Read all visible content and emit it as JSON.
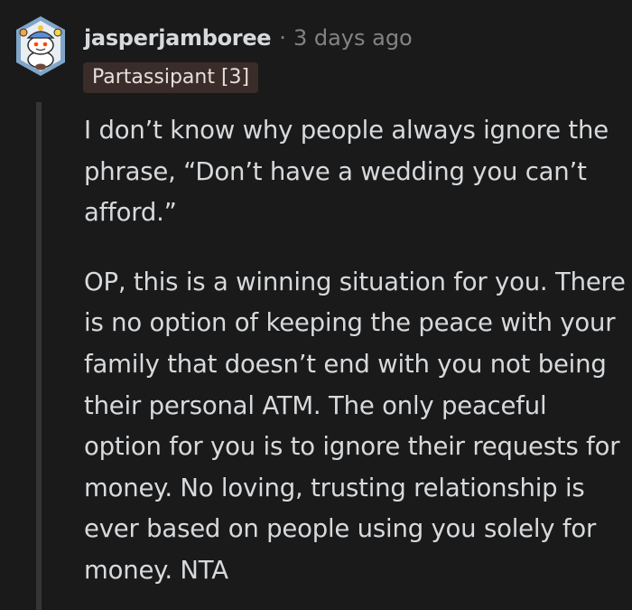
{
  "comment": {
    "author": "jasperjamboree",
    "separator": "·",
    "timestamp": "3 days ago",
    "flair": "Partassipant [3]",
    "avatar_icon": "snoo-avatar-icon",
    "paragraphs": [
      "I don’t know why people always ignore the phrase, “Don’t have a wedding you can’t afford.”",
      "OP, this is a winning situation for you. There is no option of keeping the peace with your family that doesn’t end with you not being their personal ATM. The only peaceful option for you is to ignore their requests for money. No loving, trusting relationship is ever based on people using you solely for money. NTA"
    ]
  },
  "colors": {
    "background": "#1a1a1b",
    "text": "#d7dadc",
    "meta": "#818384",
    "flair_bg": "#3a2c28",
    "thread_line": "#343536"
  }
}
